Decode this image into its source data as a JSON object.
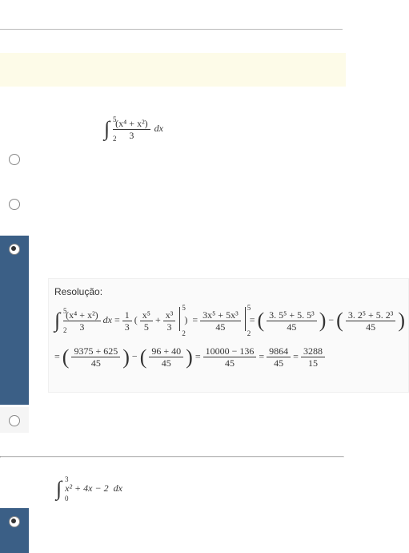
{
  "q1": {
    "integral": {
      "lower": "2",
      "upper": "5",
      "num": "(x⁴ + x²)",
      "den": "3",
      "dx": "dx"
    }
  },
  "resolution_label": "Resolução:",
  "res": {
    "line1": {
      "int_lo": "2",
      "int_up": "5",
      "f_num": "(x⁴ + x²)",
      "f_den": "3",
      "dx": "dx",
      "coef_num": "1",
      "coef_den": "3",
      "t1_num": "x⁵",
      "t1_den": "5",
      "t2_num": "x³",
      "t2_den": "3",
      "ev_up": "5",
      "ev_lo": "2",
      "comb_num": "3x⁵ + 5x³",
      "comb_den": "45",
      "sub1_num": "3. 5⁵ + 5. 5³",
      "sub1_den": "45",
      "sub2_num": "3. 2⁵ + 5. 2³",
      "sub2_den": "45"
    },
    "line2": {
      "p1_num": "9375 + 625",
      "p1_den": "45",
      "p2_num": "96 + 40",
      "p2_den": "45",
      "r1_num": "10000 − 136",
      "r1_den": "45",
      "r2_num": "9864",
      "r2_den": "45",
      "r3_num": "3288",
      "r3_den": "15"
    }
  },
  "q2": {
    "integral": {
      "lower": "0",
      "upper": "3",
      "body": "x² + 4x − 2",
      "dx": "dx"
    }
  }
}
